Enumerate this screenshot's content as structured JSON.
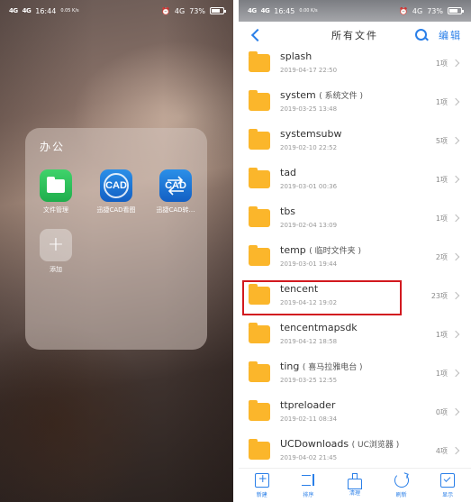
{
  "left_screen": {
    "status_bar": {
      "signal1": "4G",
      "signal2": "4G",
      "time": "16:44",
      "speed": "0.05 K/s",
      "network": "4G",
      "battery": "73%"
    },
    "folder": {
      "title": "办公",
      "apps": [
        {
          "label": "文件管理",
          "icon": "file-manager-icon"
        },
        {
          "label": "迅捷CAD看图",
          "icon": "cad-viewer-icon"
        },
        {
          "label": "迅捷CAD转…",
          "icon": "cad-converter-icon"
        },
        {
          "label": "添加",
          "icon": "plus-icon"
        }
      ],
      "cad_text": "CAD"
    }
  },
  "right_screen": {
    "status_bar": {
      "signal1": "4G",
      "signal2": "4G",
      "time": "16:45",
      "speed": "0.00 K/s",
      "network": "4G",
      "battery": "73%"
    },
    "header": {
      "title": "所有文件",
      "edit_label": "编辑"
    },
    "files": [
      {
        "name": "splash",
        "note": "",
        "date": "2019-04-17 22:50",
        "count": "1项"
      },
      {
        "name": "system",
        "note": "( 系统文件 )",
        "date": "2019-03-25 13:48",
        "count": "1项"
      },
      {
        "name": "systemsubw",
        "note": "",
        "date": "2019-02-10 22:52",
        "count": "5项"
      },
      {
        "name": "tad",
        "note": "",
        "date": "2019-03-01 00:36",
        "count": "1项"
      },
      {
        "name": "tbs",
        "note": "",
        "date": "2019-02-04 13:09",
        "count": "1项"
      },
      {
        "name": "temp",
        "note": "( 临时文件夹 )",
        "date": "2019-03-01 19:44",
        "count": "2项"
      },
      {
        "name": "tencent",
        "note": "",
        "date": "2019-04-12 19:02",
        "count": "23项"
      },
      {
        "name": "tencentmapsdk",
        "note": "",
        "date": "2019-04-12 18:58",
        "count": "1项"
      },
      {
        "name": "ting",
        "note": "( 喜马拉雅电台 )",
        "date": "2019-03-25 12:55",
        "count": "1项"
      },
      {
        "name": "ttpreloader",
        "note": "",
        "date": "2019-02-11 08:34",
        "count": "0项"
      },
      {
        "name": "UCDownloads",
        "note": "( UC浏览器 )",
        "date": "2019-04-02 21:45",
        "count": "4项"
      }
    ],
    "bottom_bar": [
      {
        "label": "新建",
        "icon": "new-folder-icon"
      },
      {
        "label": "排序",
        "icon": "sort-icon"
      },
      {
        "label": "清理",
        "icon": "clean-icon"
      },
      {
        "label": "刷新",
        "icon": "refresh-icon"
      },
      {
        "label": "显示",
        "icon": "show-icon"
      }
    ],
    "highlight_color": "#d2191f",
    "accent_color": "#2a7fe8",
    "folder_color": "#fbb62b"
  }
}
